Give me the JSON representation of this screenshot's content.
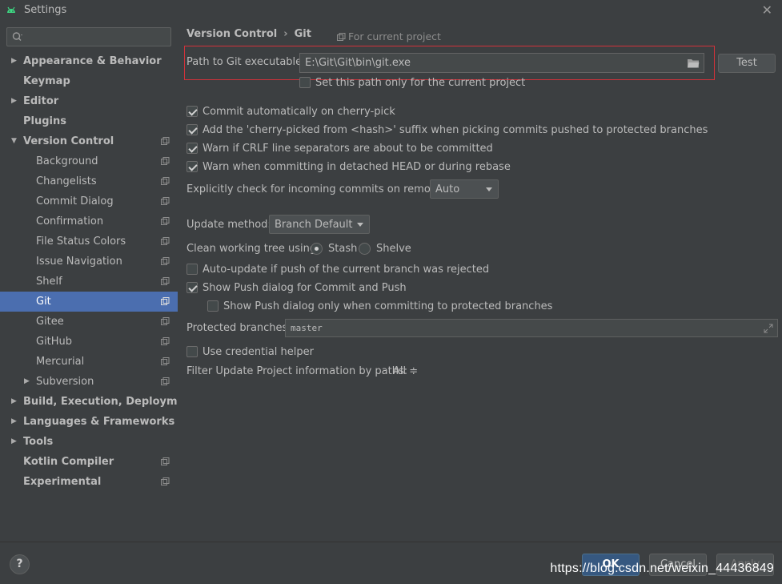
{
  "window": {
    "title": "Settings"
  },
  "search": {
    "placeholder": ""
  },
  "sidebar": {
    "items": [
      {
        "label": "Appearance & Behavior",
        "level": 0,
        "bold": true,
        "arrow": "collapsed",
        "project": false
      },
      {
        "label": "Keymap",
        "level": 0,
        "bold": true,
        "arrow": "none",
        "project": false
      },
      {
        "label": "Editor",
        "level": 0,
        "bold": true,
        "arrow": "collapsed",
        "project": false
      },
      {
        "label": "Plugins",
        "level": 0,
        "bold": true,
        "arrow": "none",
        "project": false
      },
      {
        "label": "Version Control",
        "level": 0,
        "bold": true,
        "arrow": "expanded",
        "project": true
      },
      {
        "label": "Background",
        "level": 1,
        "bold": false,
        "arrow": "none",
        "project": true
      },
      {
        "label": "Changelists",
        "level": 1,
        "bold": false,
        "arrow": "none",
        "project": true
      },
      {
        "label": "Commit Dialog",
        "level": 1,
        "bold": false,
        "arrow": "none",
        "project": true
      },
      {
        "label": "Confirmation",
        "level": 1,
        "bold": false,
        "arrow": "none",
        "project": true
      },
      {
        "label": "File Status Colors",
        "level": 1,
        "bold": false,
        "arrow": "none",
        "project": true
      },
      {
        "label": "Issue Navigation",
        "level": 1,
        "bold": false,
        "arrow": "none",
        "project": true
      },
      {
        "label": "Shelf",
        "level": 1,
        "bold": false,
        "arrow": "none",
        "project": true
      },
      {
        "label": "Git",
        "level": 1,
        "bold": false,
        "arrow": "none",
        "project": true,
        "selected": true
      },
      {
        "label": "Gitee",
        "level": 1,
        "bold": false,
        "arrow": "none",
        "project": true
      },
      {
        "label": "GitHub",
        "level": 1,
        "bold": false,
        "arrow": "none",
        "project": true
      },
      {
        "label": "Mercurial",
        "level": 1,
        "bold": false,
        "arrow": "none",
        "project": true
      },
      {
        "label": "Subversion",
        "level": 1,
        "bold": false,
        "arrow": "collapsed",
        "project": true
      },
      {
        "label": "Build, Execution, Deployment",
        "level": 0,
        "bold": true,
        "arrow": "collapsed",
        "project": false
      },
      {
        "label": "Languages & Frameworks",
        "level": 0,
        "bold": true,
        "arrow": "collapsed",
        "project": false
      },
      {
        "label": "Tools",
        "level": 0,
        "bold": true,
        "arrow": "collapsed",
        "project": false
      },
      {
        "label": "Kotlin Compiler",
        "level": 0,
        "bold": true,
        "arrow": "none",
        "project": true
      },
      {
        "label": "Experimental",
        "level": 0,
        "bold": true,
        "arrow": "none",
        "project": true
      }
    ]
  },
  "main": {
    "breadcrumb": {
      "parent": "Version Control",
      "separator": "›",
      "current": "Git"
    },
    "for_project": "For current project",
    "path": {
      "label": "Path to Git executable:",
      "value": "E:\\Git\\Git\\bin\\git.exe",
      "test_label": "Test",
      "current_project_only": {
        "label": "Set this path only for the current project",
        "checked": false
      }
    },
    "options": {
      "commit_cherry_pick": {
        "label": "Commit automatically on cherry-pick",
        "checked": true
      },
      "add_suffix": {
        "label": "Add the 'cherry-picked from <hash>' suffix when picking commits pushed to protected branches",
        "checked": true
      },
      "warn_crlf": {
        "label": "Warn if CRLF line separators are about to be committed",
        "checked": true
      },
      "warn_detached": {
        "label": "Warn when committing in detached HEAD or during rebase",
        "checked": true
      }
    },
    "incoming": {
      "label": "Explicitly check for incoming commits on remotes:",
      "value": "Auto"
    },
    "update_method": {
      "label": "Update method:",
      "value": "Branch Default"
    },
    "clean_tree": {
      "label": "Clean working tree using:",
      "stash": "Stash",
      "shelve": "Shelve",
      "selected": "Stash"
    },
    "auto_update": {
      "label": "Auto-update if push of the current branch was rejected",
      "checked": false
    },
    "show_push": {
      "label": "Show Push dialog for Commit and Push",
      "checked": true
    },
    "show_push_protected": {
      "label": "Show Push dialog only when committing to protected branches",
      "checked": false
    },
    "protected": {
      "label": "Protected branches:",
      "value": "master"
    },
    "credential": {
      "label": "Use credential helper",
      "checked": false
    },
    "filter": {
      "label": "Filter Update Project information by paths:",
      "value": "All ≑"
    }
  },
  "footer": {
    "help": "?",
    "ok": "OK",
    "cancel": "Cancel",
    "apply": "Apply",
    "watermark": "https://blog.csdn.net/weixin_44436849"
  },
  "colors": {
    "background": "#3c3f41",
    "selection": "#4b6eaf",
    "highlight_box": "#d2323a",
    "primary_button": "#365880"
  }
}
